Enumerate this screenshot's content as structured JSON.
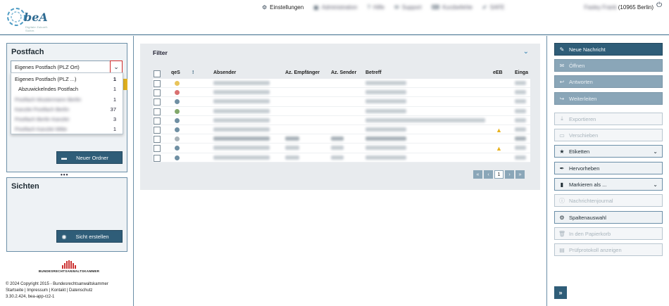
{
  "header": {
    "logo_text": "beA",
    "logo_sub": "Digitale Zukunft. Sicher.",
    "nav": [
      {
        "icon": "gear-icon",
        "label": "Einstellungen",
        "blurred": false
      },
      {
        "icon": "admin-icon",
        "label": "Administration",
        "blurred": true
      },
      {
        "icon": "help-icon",
        "label": "Hilfe",
        "blurred": true
      },
      {
        "icon": "support-icon",
        "label": "Support",
        "blurred": true
      },
      {
        "icon": "shortcuts-icon",
        "label": "Kurzbefehle",
        "blurred": true
      },
      {
        "icon": "check-icon",
        "label": "SAFE",
        "blurred": true
      }
    ],
    "user_name": "Fasley Frank",
    "user_location": "(10965 Berlin)"
  },
  "postfach": {
    "title": "Postfach",
    "selected": "Eigenes Postfach (PLZ Ort)",
    "options": [
      {
        "label": "Eigenes Postfach (PLZ ...)",
        "count": "1",
        "bold": true
      },
      {
        "label": "Abzuwickelndes Postfach",
        "count": "1",
        "bold": false
      },
      {
        "label": "Postfach Mustermann Berlin",
        "count": "1",
        "bold": false
      },
      {
        "label": "Kanzlei Postfach Berlin",
        "count": "37",
        "bold": false
      },
      {
        "label": "Postfach Berlin Kanzlei",
        "count": "3",
        "bold": false
      },
      {
        "label": "Postfach Kanzlei Mitte",
        "count": "1",
        "bold": false
      }
    ],
    "new_folder": "Neuer Ordner"
  },
  "sichten": {
    "title": "Sichten",
    "create": "Sicht erstellen"
  },
  "brak": {
    "name": "BUNDESRECHTSANWALTSKAMMER"
  },
  "footer": {
    "copyright": "© 2024 Copyright 2015 - Bundesrechtsanwaltskammer",
    "links": "Startseite | Impressum | Kontakt | Datenschutz",
    "version": "3.30.2.424, bea-app-rz2-1"
  },
  "filter": {
    "title": "Filter"
  },
  "table": {
    "columns": [
      "qeS",
      "!",
      "Absender",
      "Az. Empfänger",
      "Az. Sender",
      "Betreff",
      "eEB",
      "Einga"
    ],
    "rows": [
      {
        "dot": "#e8c45a",
        "warn": false,
        "bold": false
      },
      {
        "dot": "#d97070",
        "warn": false,
        "bold": false
      },
      {
        "dot": "#6f8fa3",
        "warn": false,
        "bold": false
      },
      {
        "dot": "#82a86a",
        "warn": false,
        "bold": false
      },
      {
        "dot": "#6f8fa3",
        "warn": false,
        "bold": false
      },
      {
        "dot": "#6f8fa3",
        "warn": true,
        "bold": false
      },
      {
        "dot": "#a8b2b8",
        "warn": false,
        "bold": true
      },
      {
        "dot": "#6f8fa3",
        "warn": true,
        "bold": false
      },
      {
        "dot": "#6f8fa3",
        "warn": false,
        "bold": false
      }
    ],
    "pager": {
      "first": "«",
      "prev": "‹",
      "page": "1",
      "next": "›",
      "last": "»"
    }
  },
  "actions": [
    {
      "name": "new-message-button",
      "icon": "pencil-icon",
      "glyph": "✎",
      "label": "Neue Nachricht",
      "style": "primary",
      "chev": false
    },
    {
      "name": "open-button",
      "icon": "envelope-icon",
      "glyph": "✉",
      "label": "Öffnen",
      "style": "disabled",
      "chev": false
    },
    {
      "name": "reply-button",
      "icon": "reply-icon",
      "glyph": "↩",
      "label": "Antworten",
      "style": "disabled",
      "chev": false
    },
    {
      "name": "forward-button",
      "icon": "forward-icon",
      "glyph": "↪",
      "label": "Weiterleiten",
      "style": "disabled",
      "chev": false
    },
    {
      "name": "export-button",
      "icon": "download-icon",
      "glyph": "⤓",
      "label": "Exportieren",
      "style": "outline-dis",
      "chev": false
    },
    {
      "name": "move-button",
      "icon": "folder-icon",
      "glyph": "▭",
      "label": "Verschieben",
      "style": "outline-dis",
      "chev": false
    },
    {
      "name": "labels-button",
      "icon": "star-icon",
      "glyph": "★",
      "label": "Etiketten",
      "style": "outline",
      "chev": true
    },
    {
      "name": "highlight-button",
      "icon": "marker-icon",
      "glyph": "✒",
      "label": "Hervorheben",
      "style": "outline",
      "chev": false
    },
    {
      "name": "mark-as-button",
      "icon": "bookmark-icon",
      "glyph": "▮",
      "label": "Markieren als ...",
      "style": "outline",
      "chev": true
    },
    {
      "name": "message-journal-button",
      "icon": "info-icon",
      "glyph": "ⓘ",
      "label": "Nachrichtenjournal",
      "style": "outline-dis",
      "chev": false
    },
    {
      "name": "columns-button",
      "icon": "gear-icon",
      "glyph": "⚙",
      "label": "Spaltenauswahl",
      "style": "outline",
      "chev": false
    },
    {
      "name": "trash-button",
      "icon": "trash-icon",
      "glyph": "🗑",
      "label": "In den Papierkorb",
      "style": "outline-dis",
      "chev": false
    },
    {
      "name": "audit-log-button",
      "icon": "document-icon",
      "glyph": "▤",
      "label": "Prüfprotokoll anzeigen",
      "style": "outline-dis",
      "chev": false
    }
  ],
  "expand": "»"
}
